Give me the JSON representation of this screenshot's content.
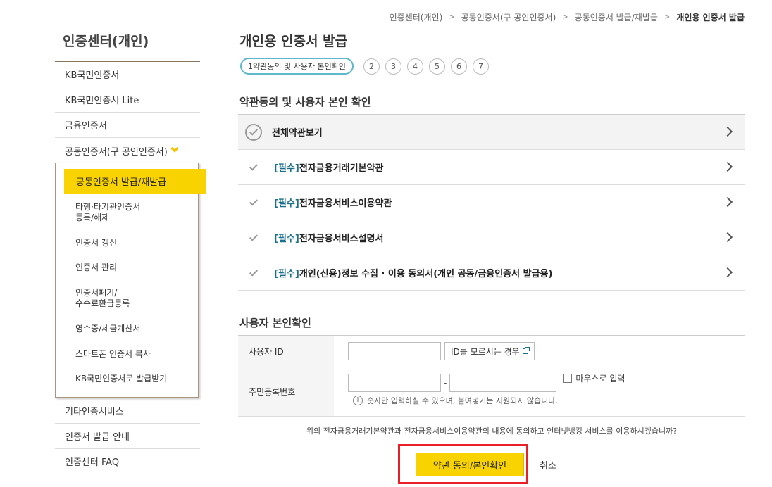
{
  "breadcrumb": [
    "인증센터(개인)",
    "공동인증서(구 공인인증서)",
    "공동인증서 발급/재발급",
    "개인용 인증서 발급"
  ],
  "sidebar": {
    "title": "인증센터(개인)",
    "items_top": [
      "KB국민인증서",
      "KB국민인증서 Lite",
      "금융인증서",
      "공동인증서(구 공인인증서)"
    ],
    "sub_active": "공동인증서 발급/재발급",
    "sub_items": [
      "타행·타기관인증서\n등록/해제",
      "인증서 갱신",
      "인증서 관리",
      "인증서폐기/\n수수료환급등록",
      "영수증/세금계산서",
      "스마트폰 인증서 복사",
      "KB국민인증서로 발급받기"
    ],
    "items_bottom": [
      "기타인증서비스",
      "인증서 발급 안내",
      "인증센터 FAQ"
    ]
  },
  "page_title": "개인용 인증서 발급",
  "steps": {
    "current": "1약관동의 및 사용자 본인확인",
    "others": [
      "2",
      "3",
      "4",
      "5",
      "6",
      "7"
    ]
  },
  "terms_section": {
    "heading": "약관동의 및 사용자 본인 확인",
    "all_label": "전체약관보기",
    "required_tag": "[필수]",
    "items": [
      "전자금융거래기본약관",
      "전자금융서비스이용약관",
      "전자금융서비스설명서",
      "개인(신용)정보 수집 · 이용 동의서(개인 공동/금융인증서 발급용)"
    ]
  },
  "identity_section": {
    "heading": "사용자 본인확인",
    "user_id_label": "사용자 ID",
    "find_id_button": "ID를 모르시는 경우",
    "rrn_label": "주민등록번호",
    "dash": "-",
    "mouse_input_label": "마우스로 입력",
    "info_note": "숫자만 입력하실 수 있으며, 붙여넣기는 지원되지 않습니다."
  },
  "consent_question": "위의 전자금융거래기본약관과 전자금융서비스이용약관의 내용에 동의하고 인터넷뱅킹 서비스를 이용하시겠습니까?",
  "buttons": {
    "agree": "약관 동의/본인확인",
    "cancel": "취소"
  },
  "colors": {
    "accent_yellow": "#f9d300",
    "highlight_red": "#e81f26",
    "required_blue": "#1b6f8a",
    "step_border": "#5fb7c9"
  }
}
